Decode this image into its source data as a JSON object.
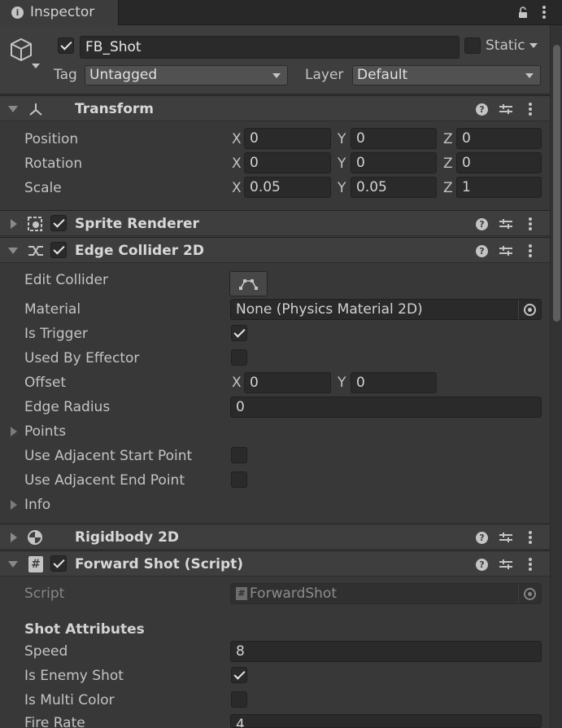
{
  "window": {
    "tab_title": "Inspector"
  },
  "gameobject": {
    "active": true,
    "name": "FB_Shot",
    "static_label": "Static",
    "static": false,
    "tag_label": "Tag",
    "tag_value": "Untagged",
    "layer_label": "Layer",
    "layer_value": "Default"
  },
  "transform": {
    "title": "Transform",
    "rows": [
      {
        "label": "Position",
        "x": "0",
        "y": "0",
        "z": "0"
      },
      {
        "label": "Rotation",
        "x": "0",
        "y": "0",
        "z": "0"
      },
      {
        "label": "Scale",
        "x": "0.05",
        "y": "0.05",
        "z": "1"
      }
    ]
  },
  "axes": {
    "x": "X",
    "y": "Y",
    "z": "Z"
  },
  "sprite_renderer": {
    "title": "Sprite Renderer",
    "enabled": true
  },
  "edge_collider": {
    "title": "Edge Collider 2D",
    "enabled": true,
    "edit_collider_label": "Edit Collider",
    "material_label": "Material",
    "material_value": "None (Physics Material 2D)",
    "is_trigger_label": "Is Trigger",
    "is_trigger": true,
    "used_by_effector_label": "Used By Effector",
    "used_by_effector": false,
    "offset_label": "Offset",
    "offset_x": "0",
    "offset_y": "0",
    "edge_radius_label": "Edge Radius",
    "edge_radius": "0",
    "points_label": "Points",
    "adj_start_label": "Use Adjacent Start Point",
    "adj_start": false,
    "adj_end_label": "Use Adjacent End Point",
    "adj_end": false,
    "info_label": "Info"
  },
  "rigidbody": {
    "title": "Rigidbody 2D"
  },
  "forward_shot": {
    "title": "Forward Shot (Script)",
    "enabled": true,
    "script_label": "Script",
    "script_value": "ForwardShot",
    "section_header": "Shot Attributes",
    "speed_label": "Speed",
    "speed": "8",
    "is_enemy_label": "Is Enemy Shot",
    "is_enemy": true,
    "is_multi_label": "Is Multi Color",
    "is_multi": false,
    "fire_rate_label": "Fire Rate",
    "fire_rate": "4"
  },
  "icons": {
    "tab": "info-icon",
    "gameobject": "cube-icon",
    "transform": "transform-axes-icon",
    "sprite_renderer": "sprite-renderer-icon",
    "edge_collider": "edge-collider-icon",
    "rigidbody": "rigidbody-icon",
    "script": "script-hash-icon",
    "help": "help-icon",
    "presets": "presets-icon",
    "more": "kebab-menu-icon",
    "lock": "lock-icon",
    "object_picker": "object-picker-icon"
  }
}
